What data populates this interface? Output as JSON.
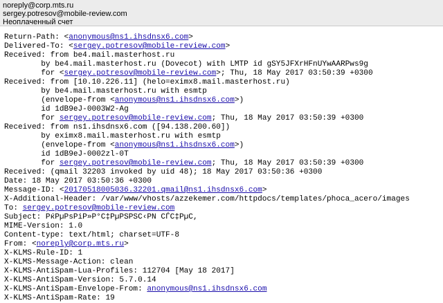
{
  "header": {
    "from": "noreply@corp.mts.ru",
    "to": "sergey.potresov@mobile-review.com",
    "subject": "Неоплаченный счет"
  },
  "source_lines": [
    [
      {
        "t": "Return-Path: <"
      },
      {
        "t": "anonymous@ns1.ihsdnsx6.com",
        "link": true
      },
      {
        "t": ">"
      }
    ],
    [
      {
        "t": "Delivered-To: <"
      },
      {
        "t": "sergey.potresov@mobile-review.com",
        "link": true
      },
      {
        "t": ">"
      }
    ],
    [
      {
        "t": "Received: from be4.mail.masterhost.ru"
      }
    ],
    [
      {
        "t": "        by be4.mail.masterhost.ru (Dovecot) with LMTP id gSY5JFXrHFnUYwAARPws9g"
      }
    ],
    [
      {
        "t": "        for <"
      },
      {
        "t": "sergey.potresov@mobile-review.com",
        "link": true
      },
      {
        "t": ">; Thu, 18 May 2017 03:50:39 +0300"
      }
    ],
    [
      {
        "t": "Received: from [10.10.226.11] (helo=eximx8.mail.masterhost.ru)"
      }
    ],
    [
      {
        "t": "        by be4.mail.masterhost.ru with esmtp"
      }
    ],
    [
      {
        "t": "        (envelope-from <"
      },
      {
        "t": "anonymous@ns1.ihsdnsx6.com",
        "link": true
      },
      {
        "t": ">)"
      }
    ],
    [
      {
        "t": "        id 1dB9eJ-0003W2-Ag"
      }
    ],
    [
      {
        "t": "        for "
      },
      {
        "t": "sergey.potresov@mobile-review.com",
        "link": true
      },
      {
        "t": "; Thu, 18 May 2017 03:50:39 +0300"
      }
    ],
    [
      {
        "t": "Received: from ns1.ihsdnsx6.com ([94.138.200.60])"
      }
    ],
    [
      {
        "t": "        by eximx8.mail.masterhost.ru with esmtp"
      }
    ],
    [
      {
        "t": "        (envelope-from <"
      },
      {
        "t": "anonymous@ns1.ihsdnsx6.com",
        "link": true
      },
      {
        "t": ">)"
      }
    ],
    [
      {
        "t": "        id 1dB9eJ-0002zl-0T"
      }
    ],
    [
      {
        "t": "        for "
      },
      {
        "t": "sergey.potresov@mobile-review.com",
        "link": true
      },
      {
        "t": "; Thu, 18 May 2017 03:50:39 +0300"
      }
    ],
    [
      {
        "t": "Received: (qmail 32203 invoked by uid 48); 18 May 2017 03:50:36 +0300"
      }
    ],
    [
      {
        "t": "Date: 18 May 2017 03:50:36 +0300"
      }
    ],
    [
      {
        "t": "Message-ID: <"
      },
      {
        "t": "20170518005036.32201.qmail@ns1.ihsdnsx6.com",
        "link": true
      },
      {
        "t": ">"
      }
    ],
    [
      {
        "t": "X-Additional-Header: /var/www/vhosts/azzekemer.com/httpdocs/templates/phoca_acero/images"
      }
    ],
    [
      {
        "t": "To: "
      },
      {
        "t": "sergey.potresov@mobile-review.com",
        "link": true
      }
    ],
    [
      {
        "t": "Subject: PќPµPsPiP»P°C‡PµPSPSC‹PN CЃC‡PµC,"
      }
    ],
    [
      {
        "t": "MIME-Version: 1.0"
      }
    ],
    [
      {
        "t": "Content-type: text/html; charset=UTF-8"
      }
    ],
    [
      {
        "t": "From: <"
      },
      {
        "t": "noreply@corp.mts.ru",
        "link": true
      },
      {
        "t": ">"
      }
    ],
    [
      {
        "t": "X-KLMS-Rule-ID: 1"
      }
    ],
    [
      {
        "t": "X-KLMS-Message-Action: clean"
      }
    ],
    [
      {
        "t": "X-KLMS-AntiSpam-Lua-Profiles: 112704 [May 18 2017]"
      }
    ],
    [
      {
        "t": "X-KLMS-AntiSpam-Version: 5.7.0.14"
      }
    ],
    [
      {
        "t": "X-KLMS-AntiSpam-Envelope-From: "
      },
      {
        "t": "anonymous@ns1.ihsdnsx6.com",
        "link": true
      }
    ],
    [
      {
        "t": "X-KLMS-AntiSpam-Rate: 19"
      }
    ]
  ]
}
